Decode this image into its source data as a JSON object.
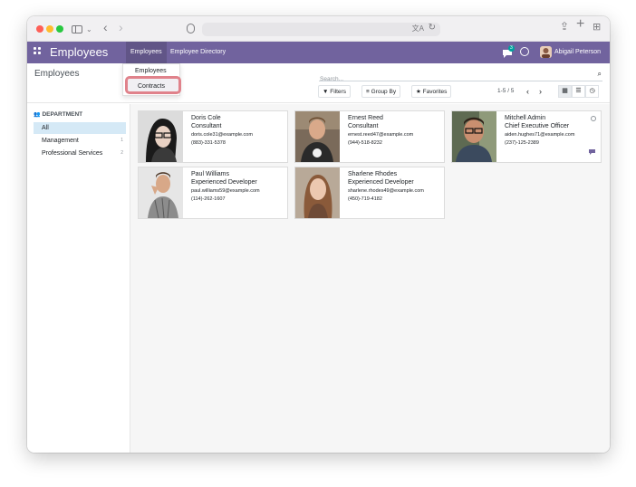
{
  "navbar": {
    "brand": "Employees",
    "menus": [
      "Employees",
      "Employee Directory"
    ],
    "chat_badge": "3",
    "user": "Abigail Peterson"
  },
  "dropdown": {
    "items": [
      "Employees",
      "Contracts"
    ],
    "highlighted": "Contracts"
  },
  "control_panel": {
    "title": "Employees",
    "search_placeholder": "Search...",
    "filters": "Filters",
    "group_by": "Group By",
    "favorites": "Favorites",
    "pager": "1-5 / 5"
  },
  "sidebar": {
    "heading": "DEPARTMENT",
    "items": [
      {
        "label": "All",
        "count": ""
      },
      {
        "label": "Management",
        "count": "1"
      },
      {
        "label": "Professional Services",
        "count": "2"
      }
    ]
  },
  "employees": [
    {
      "name": "Doris Cole",
      "job": "Consultant",
      "email": "doris.cole31@example.com",
      "phone": "(883)-331-5378"
    },
    {
      "name": "Ernest Reed",
      "job": "Consultant",
      "email": "ernest.reed47@example.com",
      "phone": "(944)-518-8232"
    },
    {
      "name": "Mitchell Admin",
      "job": "Chief Executive Officer",
      "email": "aiden.hughes71@example.com",
      "phone": "(237)-125-2389"
    },
    {
      "name": "Paul Williams",
      "job": "Experienced Developer",
      "email": "paul.williams59@example.com",
      "phone": "(114)-262-1607"
    },
    {
      "name": "Sharlene Rhodes",
      "job": "Experienced Developer",
      "email": "sharlene.rhodes49@example.com",
      "phone": "(450)-719-4182"
    }
  ],
  "colors": {
    "navbar": "#71639e",
    "highlight_border": "#e0828b",
    "sidebar_active": "#d5e9f6"
  }
}
